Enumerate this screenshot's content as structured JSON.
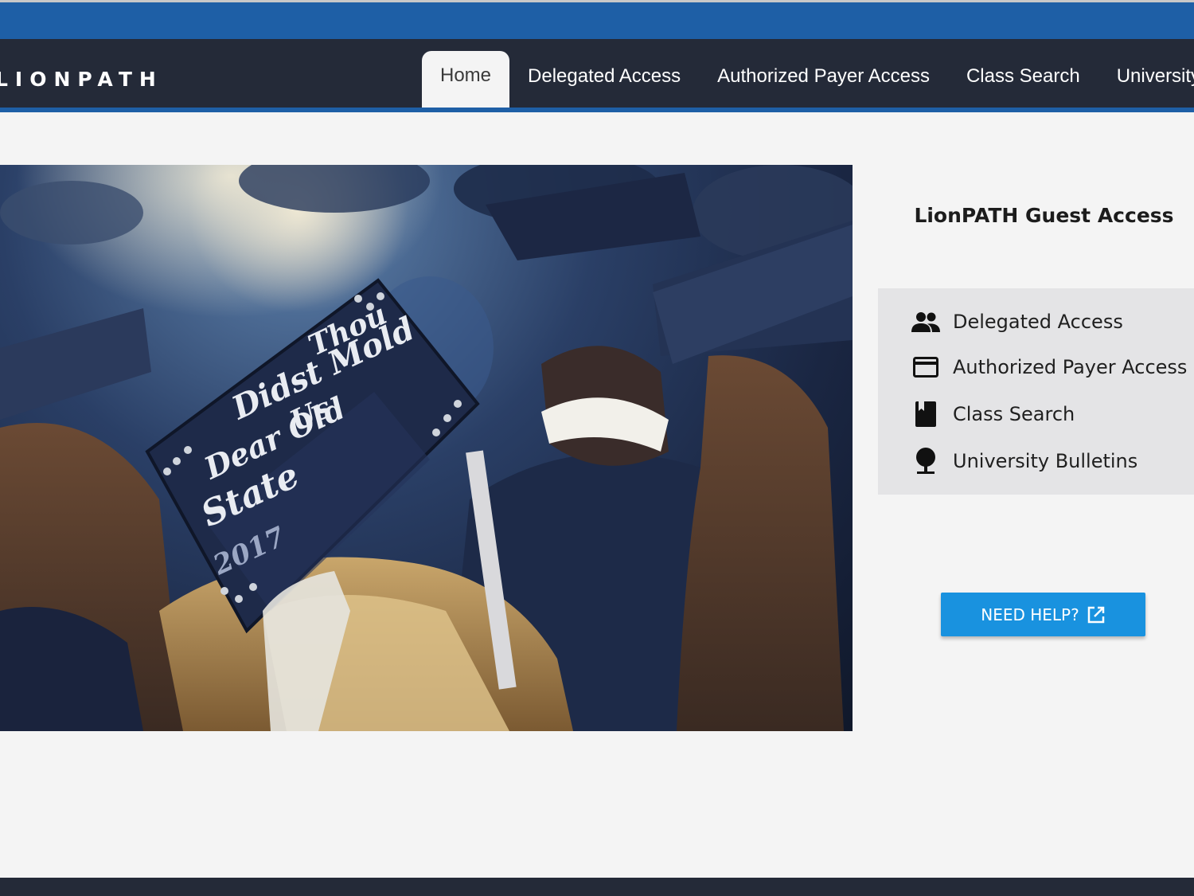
{
  "header": {
    "logo_text": "LIONPATH",
    "nav": [
      {
        "label": "Home",
        "active": true
      },
      {
        "label": "Delegated Access",
        "active": false
      },
      {
        "label": "Authorized Payer Access",
        "active": false
      },
      {
        "label": "Class Search",
        "active": false
      },
      {
        "label": "University Bulletins",
        "active": false
      }
    ]
  },
  "hero": {
    "image": "graduation-caps-photo",
    "cap_text": [
      "Thou",
      "Didst Mold",
      "Us",
      "Dear Old",
      "State",
      "2017"
    ]
  },
  "guest_panel": {
    "title": "LionPATH Guest Access",
    "links": [
      {
        "label": "Delegated Access",
        "icon": "people-icon"
      },
      {
        "label": "Authorized Payer Access",
        "icon": "credit-card-icon"
      },
      {
        "label": "Class Search",
        "icon": "book-icon"
      },
      {
        "label": "University Bulletins",
        "icon": "tree-icon"
      }
    ],
    "help_button": {
      "label": "NEED HELP?",
      "icon": "external-link-icon"
    }
  },
  "colors": {
    "top_bar": "#1e5fa6",
    "header": "#242a38",
    "background": "#f4f4f4",
    "panel_box": "#e4e4e6",
    "help_button": "#1992df"
  }
}
